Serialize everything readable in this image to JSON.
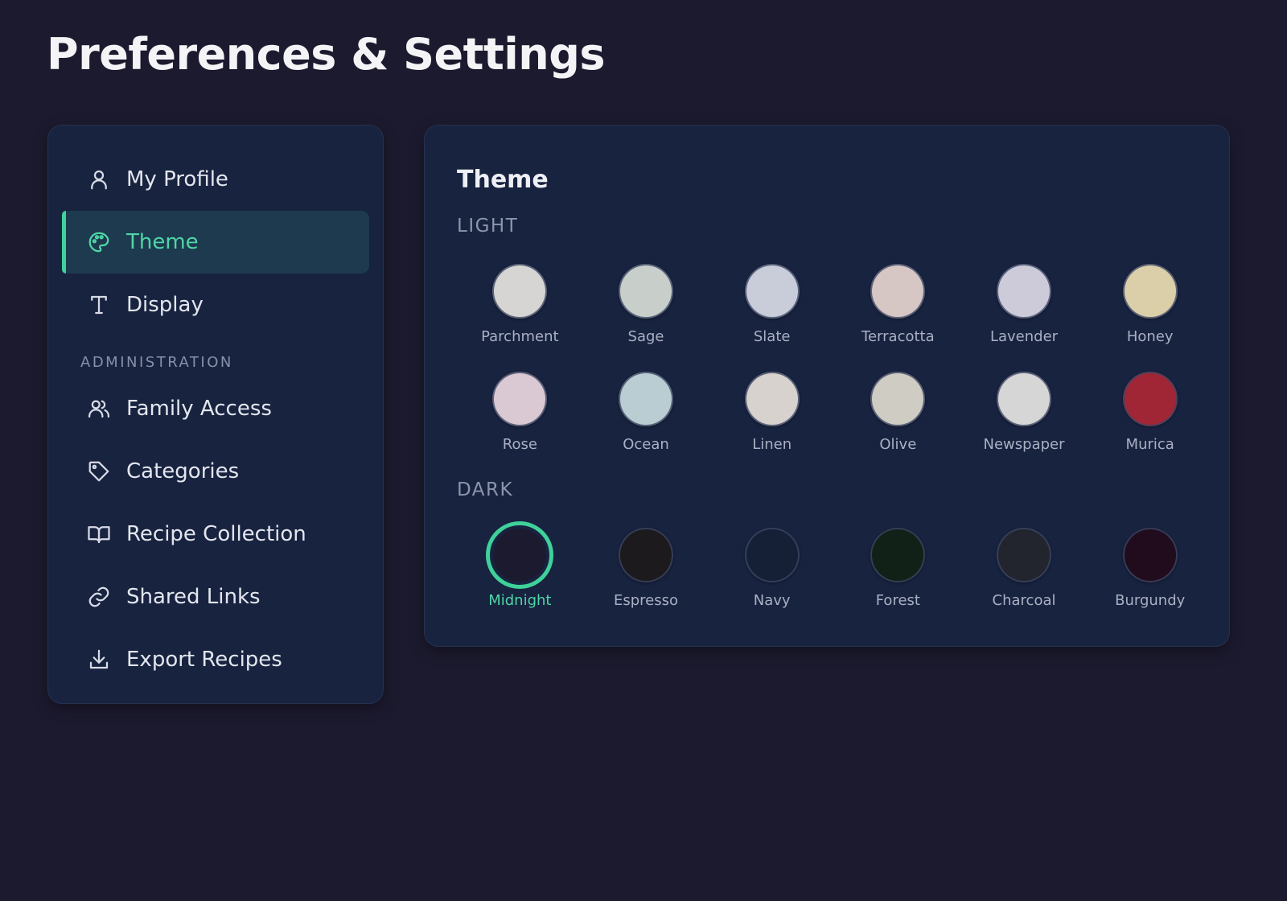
{
  "page": {
    "title": "Preferences & Settings"
  },
  "sidebar": {
    "items_top": [
      {
        "label": "My Profile",
        "icon": "user-icon",
        "active": false
      },
      {
        "label": "Theme",
        "icon": "palette-icon",
        "active": true
      },
      {
        "label": "Display",
        "icon": "type-icon",
        "active": false
      }
    ],
    "section_label": "ADMINISTRATION",
    "items_admin": [
      {
        "label": "Family Access",
        "icon": "users-icon"
      },
      {
        "label": "Categories",
        "icon": "tag-icon"
      },
      {
        "label": "Recipe Collection",
        "icon": "book-icon"
      },
      {
        "label": "Shared Links",
        "icon": "link-icon"
      },
      {
        "label": "Export Recipes",
        "icon": "download-icon"
      }
    ]
  },
  "theme_panel": {
    "title": "Theme",
    "light_label": "LIGHT",
    "dark_label": "DARK",
    "light_row1": [
      {
        "name": "Parchment",
        "color": "#d6d5d3"
      },
      {
        "name": "Sage",
        "color": "#c8cfcb"
      },
      {
        "name": "Slate",
        "color": "#c8cdd9"
      },
      {
        "name": "Terracotta",
        "color": "#d6c7c4"
      },
      {
        "name": "Lavender",
        "color": "#cdcbda"
      },
      {
        "name": "Honey",
        "color": "#dbcfaa"
      }
    ],
    "light_row2": [
      {
        "name": "Rose",
        "color": "#dac8d2"
      },
      {
        "name": "Ocean",
        "color": "#b9cdd2"
      },
      {
        "name": "Linen",
        "color": "#d7d2cd"
      },
      {
        "name": "Olive",
        "color": "#cfccc4"
      },
      {
        "name": "Newspaper",
        "color": "#d6d6d6"
      },
      {
        "name": "Murica",
        "color": "#a02636"
      }
    ],
    "dark_row": [
      {
        "name": "Midnight",
        "color": "#1c1a2e",
        "selected": true
      },
      {
        "name": "Espresso",
        "color": "#1c1a1d"
      },
      {
        "name": "Navy",
        "color": "#152036"
      },
      {
        "name": "Forest",
        "color": "#122117"
      },
      {
        "name": "Charcoal",
        "color": "#22252d"
      },
      {
        "name": "Burgundy",
        "color": "#210c1e"
      }
    ]
  },
  "colors": {
    "accent": "#3fd19a",
    "background": "#1c1a2e",
    "card": "#182340"
  }
}
